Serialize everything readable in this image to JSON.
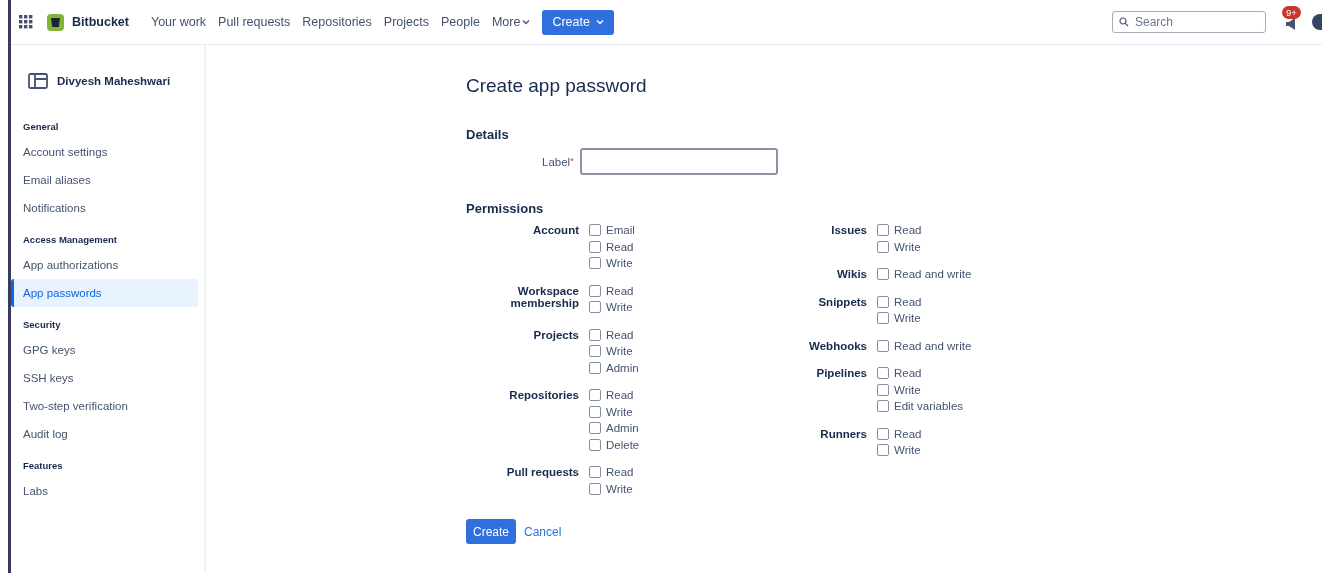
{
  "topbar": {
    "product": "Bitbucket",
    "nav": [
      {
        "label": "Your work",
        "kind": "link"
      },
      {
        "label": "Pull requests",
        "kind": "link"
      },
      {
        "label": "Repositories",
        "kind": "link"
      },
      {
        "label": "Projects",
        "kind": "link"
      },
      {
        "label": "People",
        "kind": "link"
      },
      {
        "label": "More",
        "kind": "dropdown"
      }
    ],
    "create_button": "Create",
    "search": {
      "placeholder": "Search"
    },
    "notification_badge": "9+"
  },
  "sidebar": {
    "title": "Divyesh Maheshwari",
    "sections": [
      {
        "heading": "General",
        "items": [
          {
            "label": "Account settings",
            "selected": false
          },
          {
            "label": "Email aliases",
            "selected": false
          },
          {
            "label": "Notifications",
            "selected": false
          }
        ]
      },
      {
        "heading": "Access Management",
        "items": [
          {
            "label": "App authorizations",
            "selected": false
          },
          {
            "label": "App passwords",
            "selected": true
          }
        ]
      },
      {
        "heading": "Security",
        "items": [
          {
            "label": "GPG keys",
            "selected": false
          },
          {
            "label": "SSH keys",
            "selected": false
          },
          {
            "label": "Two-step verification",
            "selected": false
          },
          {
            "label": "Audit log",
            "selected": false
          }
        ]
      },
      {
        "heading": "Features",
        "items": [
          {
            "label": "Labs",
            "selected": false
          }
        ]
      }
    ]
  },
  "form": {
    "title": "Create app password",
    "details_heading": "Details",
    "label_field": {
      "label": "Label",
      "required_mark": "*"
    },
    "permissions_heading": "Permissions",
    "permission_columns": [
      [
        {
          "name": "Account",
          "options": [
            {
              "label": "Email",
              "checked": false
            },
            {
              "label": "Read",
              "checked": false
            },
            {
              "label": "Write",
              "checked": false
            }
          ]
        },
        {
          "name": "Workspace membership",
          "options": [
            {
              "label": "Read",
              "checked": false
            },
            {
              "label": "Write",
              "checked": false
            }
          ]
        },
        {
          "name": "Projects",
          "options": [
            {
              "label": "Read",
              "checked": false
            },
            {
              "label": "Write",
              "checked": false
            },
            {
              "label": "Admin",
              "checked": false
            }
          ]
        },
        {
          "name": "Repositories",
          "options": [
            {
              "label": "Read",
              "checked": false
            },
            {
              "label": "Write",
              "checked": false
            },
            {
              "label": "Admin",
              "checked": false
            },
            {
              "label": "Delete",
              "checked": false
            }
          ]
        },
        {
          "name": "Pull requests",
          "options": [
            {
              "label": "Read",
              "checked": false
            },
            {
              "label": "Write",
              "checked": false
            }
          ]
        }
      ],
      [
        {
          "name": "Issues",
          "options": [
            {
              "label": "Read",
              "checked": false
            },
            {
              "label": "Write",
              "checked": false
            }
          ]
        },
        {
          "name": "Wikis",
          "options": [
            {
              "label": "Read and write",
              "checked": false
            }
          ]
        },
        {
          "name": "Snippets",
          "options": [
            {
              "label": "Read",
              "checked": false
            },
            {
              "label": "Write",
              "checked": false
            }
          ]
        },
        {
          "name": "Webhooks",
          "options": [
            {
              "label": "Read and write",
              "checked": false
            }
          ]
        },
        {
          "name": "Pipelines",
          "options": [
            {
              "label": "Read",
              "checked": false
            },
            {
              "label": "Write",
              "checked": false
            },
            {
              "label": "Edit variables",
              "checked": false
            }
          ]
        },
        {
          "name": "Runners",
          "options": [
            {
              "label": "Read",
              "checked": false
            },
            {
              "label": "Write",
              "checked": false
            }
          ]
        }
      ]
    ],
    "submit": "Create",
    "cancel": "Cancel"
  }
}
